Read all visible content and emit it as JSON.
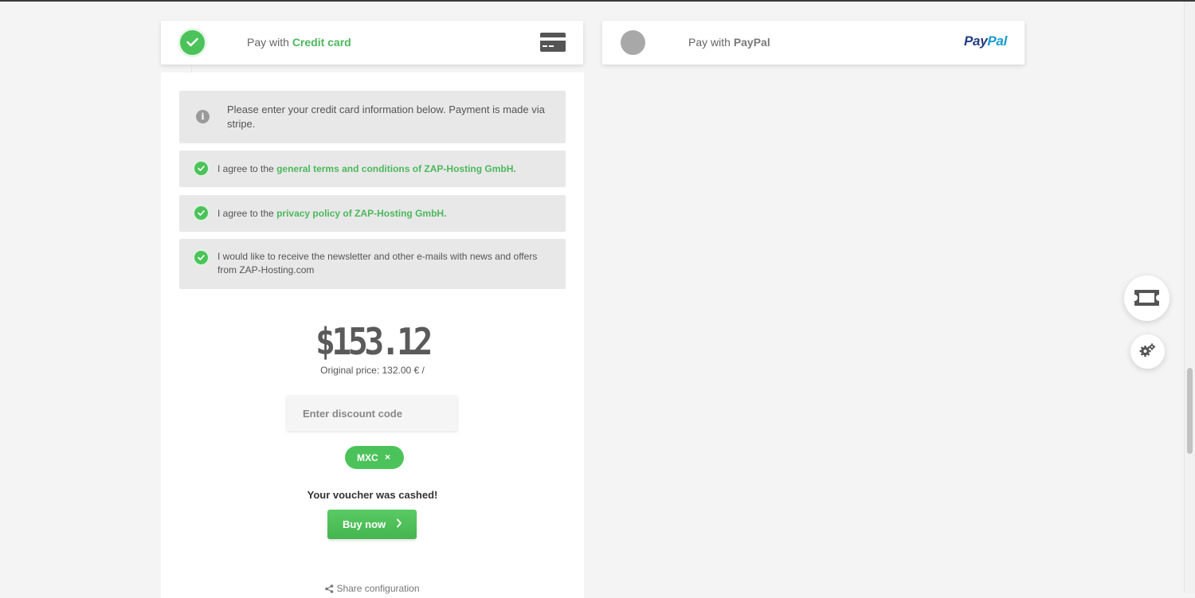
{
  "payment_options": {
    "credit_card": {
      "prefix": "Pay with",
      "name": "Credit card",
      "icon": "credit-card-icon",
      "selected": true
    },
    "paypal": {
      "prefix": "Pay with",
      "name": "PayPal",
      "logo_pay": "Pay",
      "logo_pal": "Pal",
      "selected": false
    }
  },
  "info": {
    "icon": "info-icon",
    "text": "Please enter your credit card information below. Payment is made via stripe."
  },
  "agreements": {
    "terms": {
      "prefix": "I agree to the",
      "link": "general terms and conditions of ZAP-Hosting GmbH.",
      "checked": true
    },
    "privacy": {
      "prefix": "I agree to the",
      "link": "privacy policy of ZAP-Hosting GmbH.",
      "checked": true
    },
    "newsletter": {
      "text": "I would like to receive the newsletter and other e-mails with news and offers from ZAP-Hosting.com",
      "checked": true
    }
  },
  "pricing": {
    "price": "$153.12",
    "original": "Original price: 132.00 € /"
  },
  "discount": {
    "placeholder": "Enter discount code",
    "value": "",
    "applied_code": "MXC",
    "remove_symbol": "×",
    "message": "Your voucher was cashed!"
  },
  "actions": {
    "buy_label": "Buy now",
    "share_label": "Share configuration"
  },
  "colors": {
    "accent": "#4cc35a",
    "link_green": "#4cb85c",
    "paypal_dark": "#253b80",
    "paypal_light": "#179bd7",
    "box_bg": "#e8e8e8",
    "page_bg": "#f4f4f4"
  },
  "side_buttons": {
    "ticket": "ticket-icon",
    "settings": "gears-icon"
  }
}
